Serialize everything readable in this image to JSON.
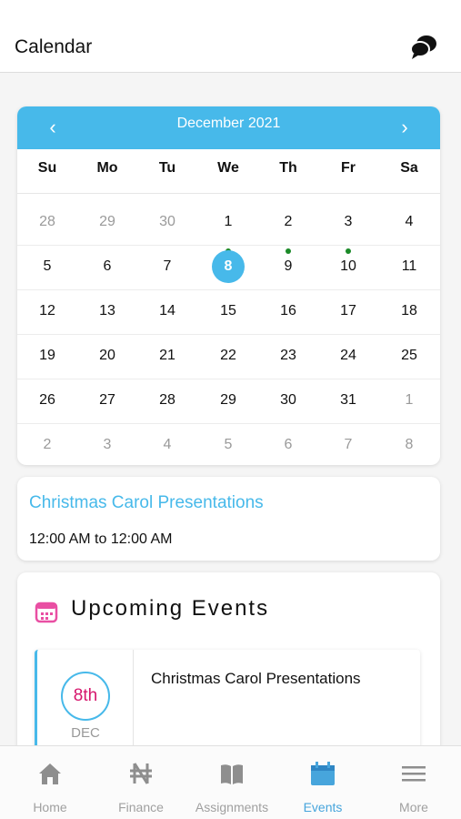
{
  "header": {
    "title": "Calendar",
    "chat_icon": "chat-bubbles-icon"
  },
  "calendar": {
    "month_label": "December 2021",
    "prev_label": "‹",
    "next_label": "›",
    "weekdays": [
      "Su",
      "Mo",
      "Tu",
      "We",
      "Th",
      "Fr",
      "Sa"
    ],
    "weeks": [
      [
        {
          "d": "28",
          "out": true
        },
        {
          "d": "29",
          "out": true
        },
        {
          "d": "30",
          "out": true
        },
        {
          "d": "1"
        },
        {
          "d": "2"
        },
        {
          "d": "3"
        },
        {
          "d": "4"
        }
      ],
      [
        {
          "d": "5"
        },
        {
          "d": "6"
        },
        {
          "d": "7"
        },
        {
          "d": "8",
          "selected": true,
          "dot": true
        },
        {
          "d": "9",
          "dot": true
        },
        {
          "d": "10",
          "dot": true
        },
        {
          "d": "11"
        }
      ],
      [
        {
          "d": "12"
        },
        {
          "d": "13"
        },
        {
          "d": "14"
        },
        {
          "d": "15"
        },
        {
          "d": "16"
        },
        {
          "d": "17"
        },
        {
          "d": "18"
        }
      ],
      [
        {
          "d": "19"
        },
        {
          "d": "20"
        },
        {
          "d": "21"
        },
        {
          "d": "22"
        },
        {
          "d": "23"
        },
        {
          "d": "24"
        },
        {
          "d": "25"
        }
      ],
      [
        {
          "d": "26"
        },
        {
          "d": "27"
        },
        {
          "d": "28"
        },
        {
          "d": "29"
        },
        {
          "d": "30"
        },
        {
          "d": "31"
        },
        {
          "d": "1",
          "out": true
        }
      ],
      [
        {
          "d": "2",
          "out": true
        },
        {
          "d": "3",
          "out": true
        },
        {
          "d": "4",
          "out": true
        },
        {
          "d": "5",
          "out": true
        },
        {
          "d": "6",
          "out": true
        },
        {
          "d": "7",
          "out": true
        },
        {
          "d": "8",
          "out": true
        }
      ]
    ],
    "accent_color": "#47b9ea",
    "event_dot_color": "#1b8a28"
  },
  "selected_event": {
    "title": "Christmas Carol Presentations",
    "time": "12:00 AM to 12:00 AM"
  },
  "upcoming": {
    "title": "Upcoming Events",
    "icon": "calendar-icon",
    "items": [
      {
        "day": "8th",
        "month": "DEC",
        "name": "Christmas Carol Presentations"
      }
    ]
  },
  "tabs": [
    {
      "label": "Home",
      "icon": "home-icon",
      "active": false
    },
    {
      "label": "Finance",
      "icon": "naira-icon",
      "active": false
    },
    {
      "label": "Assignments",
      "icon": "book-icon",
      "active": false
    },
    {
      "label": "Events",
      "icon": "calendar-icon",
      "active": true
    },
    {
      "label": "More",
      "icon": "menu-icon",
      "active": false
    }
  ]
}
